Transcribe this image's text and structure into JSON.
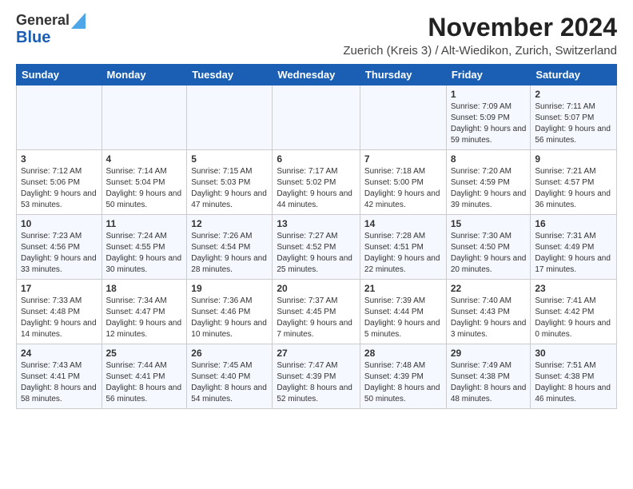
{
  "logo": {
    "line1": "General",
    "line2": "Blue"
  },
  "title": "November 2024",
  "subtitle": "Zuerich (Kreis 3) / Alt-Wiedikon, Zurich, Switzerland",
  "days_of_week": [
    "Sunday",
    "Monday",
    "Tuesday",
    "Wednesday",
    "Thursday",
    "Friday",
    "Saturday"
  ],
  "weeks": [
    [
      {
        "day": "",
        "info": ""
      },
      {
        "day": "",
        "info": ""
      },
      {
        "day": "",
        "info": ""
      },
      {
        "day": "",
        "info": ""
      },
      {
        "day": "",
        "info": ""
      },
      {
        "day": "1",
        "info": "Sunrise: 7:09 AM\nSunset: 5:09 PM\nDaylight: 9 hours and 59 minutes."
      },
      {
        "day": "2",
        "info": "Sunrise: 7:11 AM\nSunset: 5:07 PM\nDaylight: 9 hours and 56 minutes."
      }
    ],
    [
      {
        "day": "3",
        "info": "Sunrise: 7:12 AM\nSunset: 5:06 PM\nDaylight: 9 hours and 53 minutes."
      },
      {
        "day": "4",
        "info": "Sunrise: 7:14 AM\nSunset: 5:04 PM\nDaylight: 9 hours and 50 minutes."
      },
      {
        "day": "5",
        "info": "Sunrise: 7:15 AM\nSunset: 5:03 PM\nDaylight: 9 hours and 47 minutes."
      },
      {
        "day": "6",
        "info": "Sunrise: 7:17 AM\nSunset: 5:02 PM\nDaylight: 9 hours and 44 minutes."
      },
      {
        "day": "7",
        "info": "Sunrise: 7:18 AM\nSunset: 5:00 PM\nDaylight: 9 hours and 42 minutes."
      },
      {
        "day": "8",
        "info": "Sunrise: 7:20 AM\nSunset: 4:59 PM\nDaylight: 9 hours and 39 minutes."
      },
      {
        "day": "9",
        "info": "Sunrise: 7:21 AM\nSunset: 4:57 PM\nDaylight: 9 hours and 36 minutes."
      }
    ],
    [
      {
        "day": "10",
        "info": "Sunrise: 7:23 AM\nSunset: 4:56 PM\nDaylight: 9 hours and 33 minutes."
      },
      {
        "day": "11",
        "info": "Sunrise: 7:24 AM\nSunset: 4:55 PM\nDaylight: 9 hours and 30 minutes."
      },
      {
        "day": "12",
        "info": "Sunrise: 7:26 AM\nSunset: 4:54 PM\nDaylight: 9 hours and 28 minutes."
      },
      {
        "day": "13",
        "info": "Sunrise: 7:27 AM\nSunset: 4:52 PM\nDaylight: 9 hours and 25 minutes."
      },
      {
        "day": "14",
        "info": "Sunrise: 7:28 AM\nSunset: 4:51 PM\nDaylight: 9 hours and 22 minutes."
      },
      {
        "day": "15",
        "info": "Sunrise: 7:30 AM\nSunset: 4:50 PM\nDaylight: 9 hours and 20 minutes."
      },
      {
        "day": "16",
        "info": "Sunrise: 7:31 AM\nSunset: 4:49 PM\nDaylight: 9 hours and 17 minutes."
      }
    ],
    [
      {
        "day": "17",
        "info": "Sunrise: 7:33 AM\nSunset: 4:48 PM\nDaylight: 9 hours and 14 minutes."
      },
      {
        "day": "18",
        "info": "Sunrise: 7:34 AM\nSunset: 4:47 PM\nDaylight: 9 hours and 12 minutes."
      },
      {
        "day": "19",
        "info": "Sunrise: 7:36 AM\nSunset: 4:46 PM\nDaylight: 9 hours and 10 minutes."
      },
      {
        "day": "20",
        "info": "Sunrise: 7:37 AM\nSunset: 4:45 PM\nDaylight: 9 hours and 7 minutes."
      },
      {
        "day": "21",
        "info": "Sunrise: 7:39 AM\nSunset: 4:44 PM\nDaylight: 9 hours and 5 minutes."
      },
      {
        "day": "22",
        "info": "Sunrise: 7:40 AM\nSunset: 4:43 PM\nDaylight: 9 hours and 3 minutes."
      },
      {
        "day": "23",
        "info": "Sunrise: 7:41 AM\nSunset: 4:42 PM\nDaylight: 9 hours and 0 minutes."
      }
    ],
    [
      {
        "day": "24",
        "info": "Sunrise: 7:43 AM\nSunset: 4:41 PM\nDaylight: 8 hours and 58 minutes."
      },
      {
        "day": "25",
        "info": "Sunrise: 7:44 AM\nSunset: 4:41 PM\nDaylight: 8 hours and 56 minutes."
      },
      {
        "day": "26",
        "info": "Sunrise: 7:45 AM\nSunset: 4:40 PM\nDaylight: 8 hours and 54 minutes."
      },
      {
        "day": "27",
        "info": "Sunrise: 7:47 AM\nSunset: 4:39 PM\nDaylight: 8 hours and 52 minutes."
      },
      {
        "day": "28",
        "info": "Sunrise: 7:48 AM\nSunset: 4:39 PM\nDaylight: 8 hours and 50 minutes."
      },
      {
        "day": "29",
        "info": "Sunrise: 7:49 AM\nSunset: 4:38 PM\nDaylight: 8 hours and 48 minutes."
      },
      {
        "day": "30",
        "info": "Sunrise: 7:51 AM\nSunset: 4:38 PM\nDaylight: 8 hours and 46 minutes."
      }
    ]
  ]
}
